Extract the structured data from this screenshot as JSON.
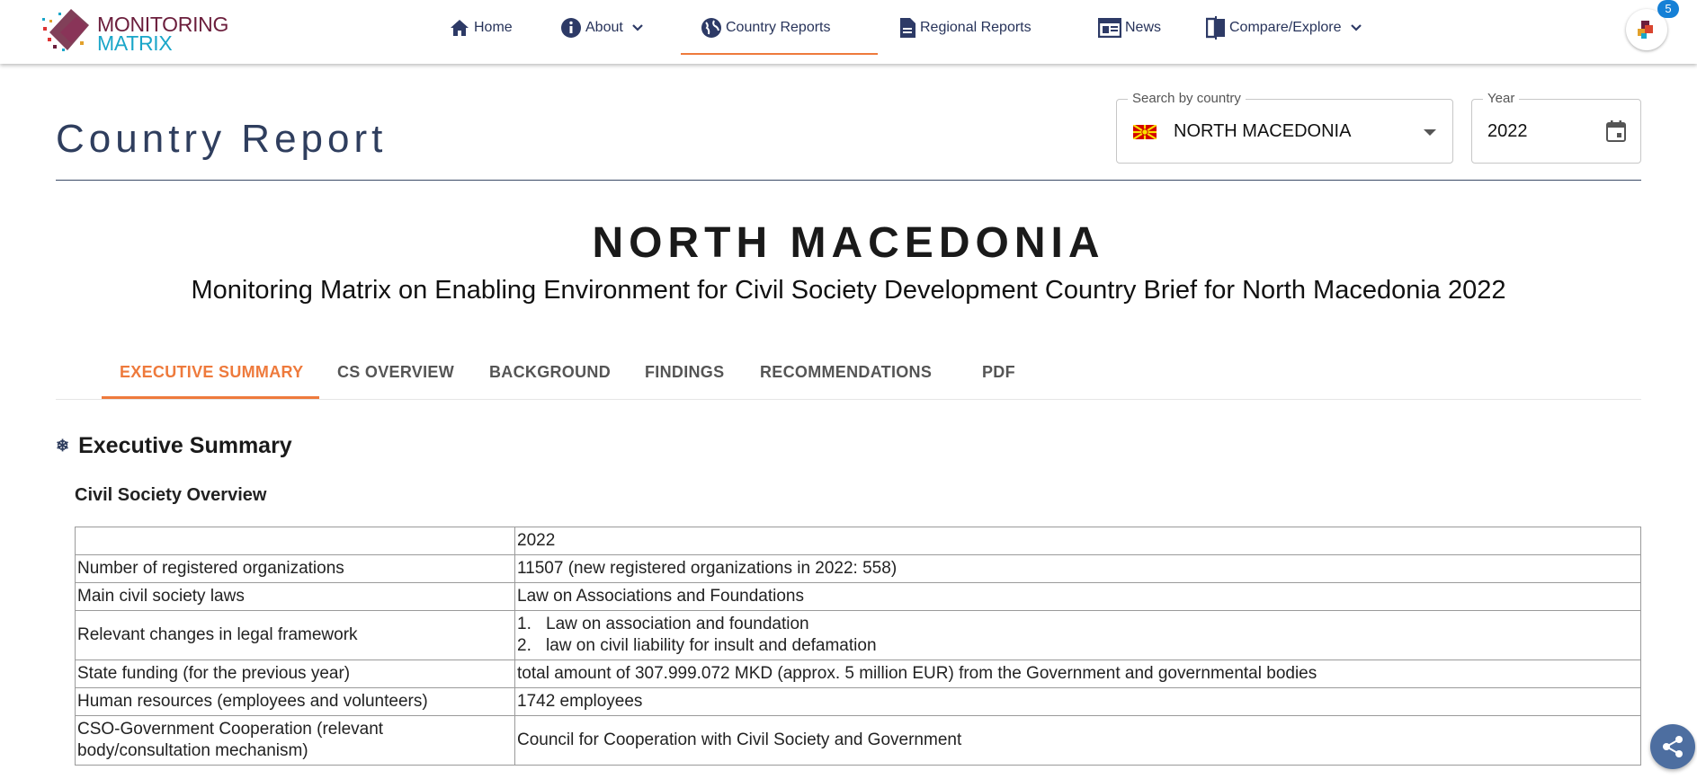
{
  "brand": {
    "line1": "MONITORING",
    "line2": "MATRIX"
  },
  "nav": {
    "items": [
      {
        "label": "Home",
        "icon": "home-icon"
      },
      {
        "label": "About",
        "icon": "info-icon"
      },
      {
        "label": "Country Reports",
        "icon": "globe-icon"
      },
      {
        "label": "Regional Reports",
        "icon": "document-icon"
      },
      {
        "label": "News",
        "icon": "newspaper-icon"
      },
      {
        "label": "Compare/Explore",
        "icon": "compare-icon"
      }
    ],
    "active": "Country Reports",
    "notification_count": "5"
  },
  "header": {
    "title": "Country Report",
    "country_field": {
      "label": "Search by country",
      "value": "NORTH MACEDONIA"
    },
    "year_field": {
      "label": "Year",
      "value": "2022"
    }
  },
  "report": {
    "country": "NORTH MACEDONIA",
    "subtitle": "Monitoring Matrix on Enabling Environment for Civil Society Development Country Brief for North Macedonia 2022"
  },
  "tabs": [
    "EXECUTIVE SUMMARY",
    "CS OVERVIEW",
    "BACKGROUND",
    "FINDINGS",
    "RECOMMENDATIONS",
    "PDF"
  ],
  "active_tab": "EXECUTIVE SUMMARY",
  "section": {
    "heading": "Executive Summary",
    "subheading": "Civil Society Overview",
    "table": {
      "header": [
        "",
        "2022"
      ],
      "rows": [
        {
          "label": "Number of registered organizations",
          "value": "11507 (new registered organizations in 2022: 558)"
        },
        {
          "label": "Main civil society laws",
          "value": "Law on Associations and Foundations"
        },
        {
          "label": "Relevant changes in legal framework",
          "list": [
            "Law on association and foundation",
            "law on civil liability for insult and defamation"
          ]
        },
        {
          "label": "State funding (for the previous year)",
          "value": "total amount of 307.999.072 MKD (approx. 5 million EUR) from the Government and governmental bodies"
        },
        {
          "label": "Human resources (employees and volunteers)",
          "value": "1742 employees"
        },
        {
          "label": "CSO-Government Cooperation (relevant body/consultation mechanism)",
          "value": "Council for Cooperation with Civil Society and Government"
        }
      ]
    }
  },
  "colors": {
    "accent": "#ee7a3c",
    "navy": "#2f3e5e",
    "brand_maroon": "#6b1e3c",
    "brand_cyan": "#1aa6c9"
  }
}
